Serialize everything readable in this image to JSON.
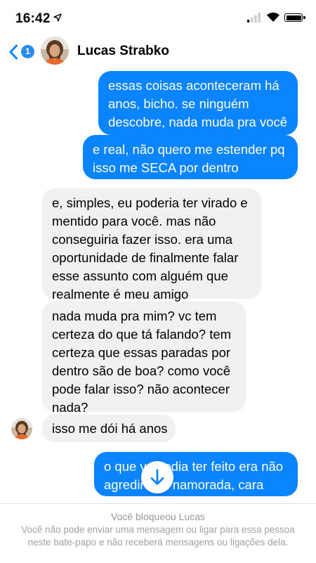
{
  "status_bar": {
    "time": "16:42",
    "location_icon": "location-arrow-icon",
    "signal_icon": "cellular-signal-icon",
    "wifi_icon": "wifi-icon",
    "battery_icon": "battery-icon"
  },
  "header": {
    "back_icon": "chevron-left-icon",
    "unread_count": "1",
    "contact_name": "Lucas Strabko",
    "accent_color": "#0a84ff"
  },
  "messages": [
    {
      "direction": "outgoing",
      "lines": [
        "essas coisas aconteceram há",
        "anos, bicho. se ninguém",
        "descobre, nada muda pra você"
      ]
    },
    {
      "direction": "outgoing",
      "lines": [
        "e real, não quero me estender pq",
        "isso me SECA por dentro"
      ]
    },
    {
      "direction": "incoming",
      "lines": [
        "e, simples, eu poderia ter virado e",
        "mentido para você. mas não",
        "conseguiria fazer isso. era uma",
        "oportunidade de finalmente falar",
        "esse assunto com alguém que",
        "realmente é meu amigo"
      ]
    },
    {
      "direction": "incoming",
      "lines": [
        "nada muda pra mim? vc tem",
        "certeza do que tá falando? tem",
        "certeza que essas paradas por",
        "dentro são de boa? como você",
        "pode falar isso? não acontecer",
        "nada?"
      ]
    },
    {
      "direction": "incoming",
      "lines": [
        "isso me dói há anos"
      ]
    },
    {
      "direction": "outgoing",
      "lines": [
        "o que vc podia ter feito era não",
        "agredir sua namorada, cara"
      ]
    }
  ],
  "scroll_down_icon": "arrow-down-icon",
  "footer": {
    "title": "Você bloqueou Lucas",
    "text": "Você não pode enviar uma mensagem ou ligar para essa pessoa neste bate-papo e não receberá mensagens ou ligações dela."
  }
}
